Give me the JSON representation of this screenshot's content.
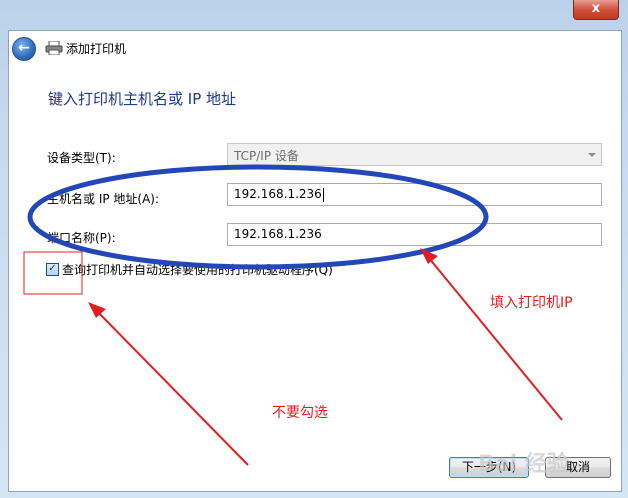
{
  "window": {
    "close_glyph": "x"
  },
  "header": {
    "title": "添加打印机",
    "back_icon": "back-arrow-icon",
    "printer_icon": "printer-icon"
  },
  "main": {
    "heading": "键入打印机主机名或 IP 地址",
    "device_type": {
      "label": "设备类型(T):",
      "value": "TCP/IP 设备"
    },
    "hostname": {
      "label": "主机名或 IP 地址(A):",
      "value": "192.168.1.236"
    },
    "port_name": {
      "label": "端口名称(P):",
      "value": "192.168.1.236"
    },
    "query_driver": {
      "label": "查询打印机并自动选择要使用的打印机驱动程序(Q)",
      "checked": true
    }
  },
  "footer": {
    "next_label": "下一步(N)",
    "cancel_label": "取消"
  },
  "annotations": {
    "fill_ip": "填入打印机IP",
    "no_check": "不要勾选",
    "color": "#e02020",
    "ellipse_color": "#2447b8"
  },
  "watermark": {
    "text": "Bai 经验"
  }
}
